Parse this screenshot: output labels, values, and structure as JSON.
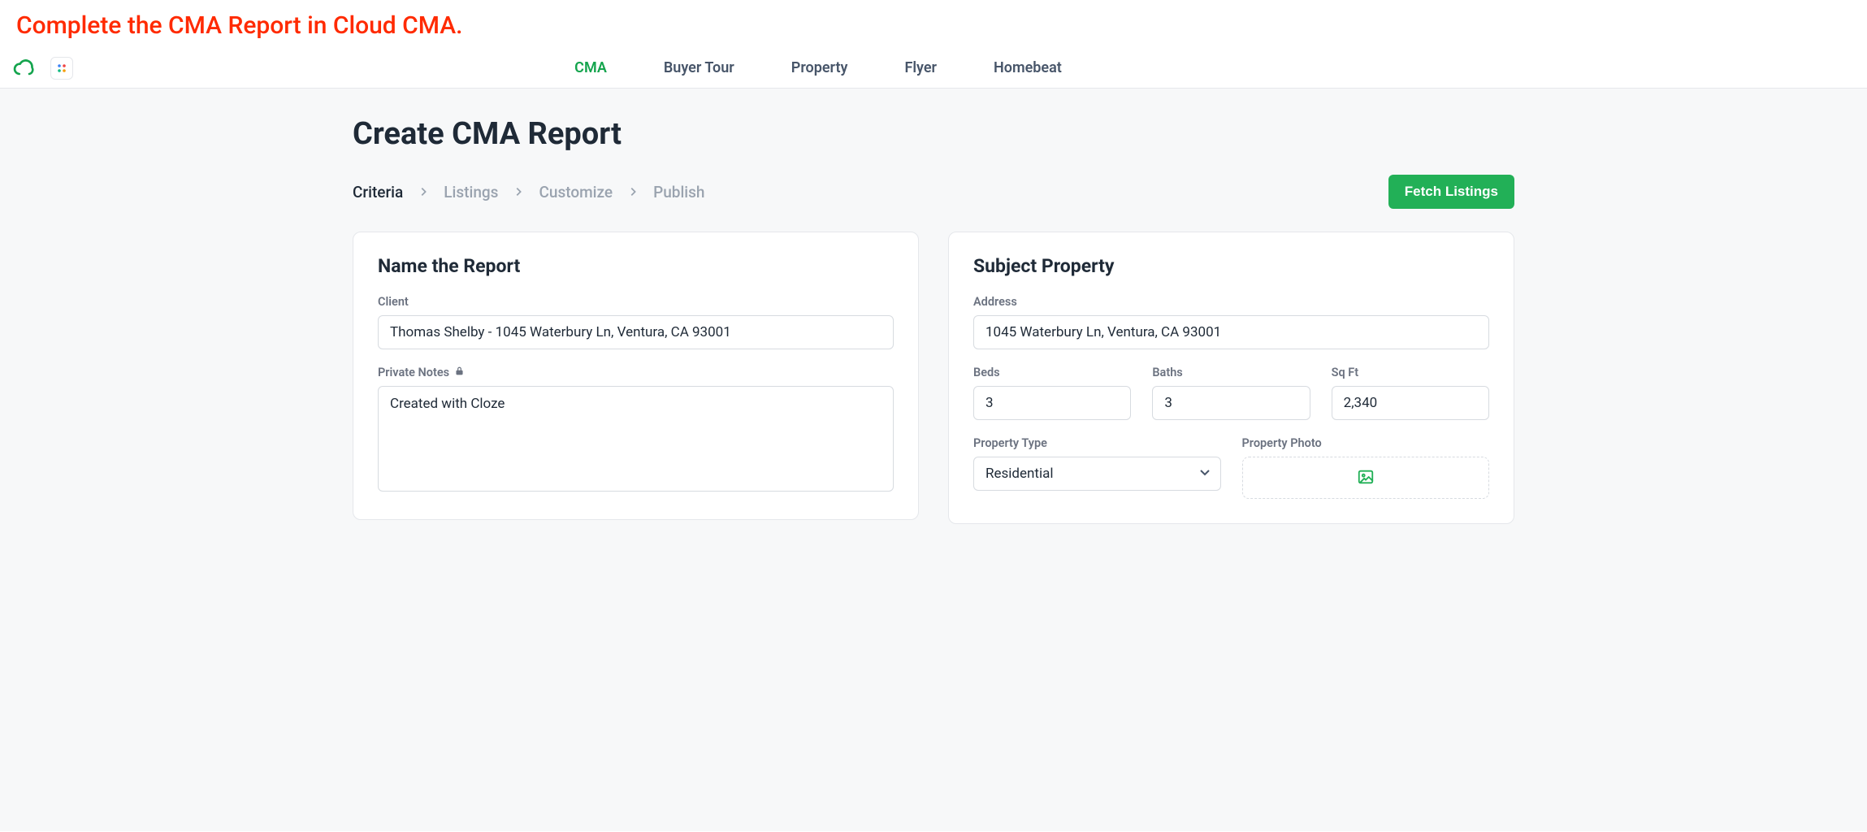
{
  "instruction": "Complete the CMA Report in Cloud CMA.",
  "nav": {
    "items": [
      "CMA",
      "Buyer Tour",
      "Property",
      "Flyer",
      "Homebeat"
    ],
    "activeIndex": 0
  },
  "page": {
    "title": "Create CMA Report",
    "steps": [
      "Criteria",
      "Listings",
      "Customize",
      "Publish"
    ],
    "currentStep": 0,
    "fetchButton": "Fetch Listings"
  },
  "nameCard": {
    "title": "Name the Report",
    "clientLabel": "Client",
    "clientValue": "Thomas Shelby - 1045 Waterbury Ln, Ventura, CA 93001",
    "notesLabel": "Private Notes",
    "notesValue": "Created with Cloze"
  },
  "subjectCard": {
    "title": "Subject Property",
    "addressLabel": "Address",
    "addressValue": "1045 Waterbury Ln, Ventura, CA 93001",
    "bedsLabel": "Beds",
    "bedsValue": "3",
    "bathsLabel": "Baths",
    "bathsValue": "3",
    "sqftLabel": "Sq Ft",
    "sqftValue": "2,340",
    "propertyTypeLabel": "Property Type",
    "propertyTypeValue": "Residential",
    "photoLabel": "Property Photo"
  }
}
